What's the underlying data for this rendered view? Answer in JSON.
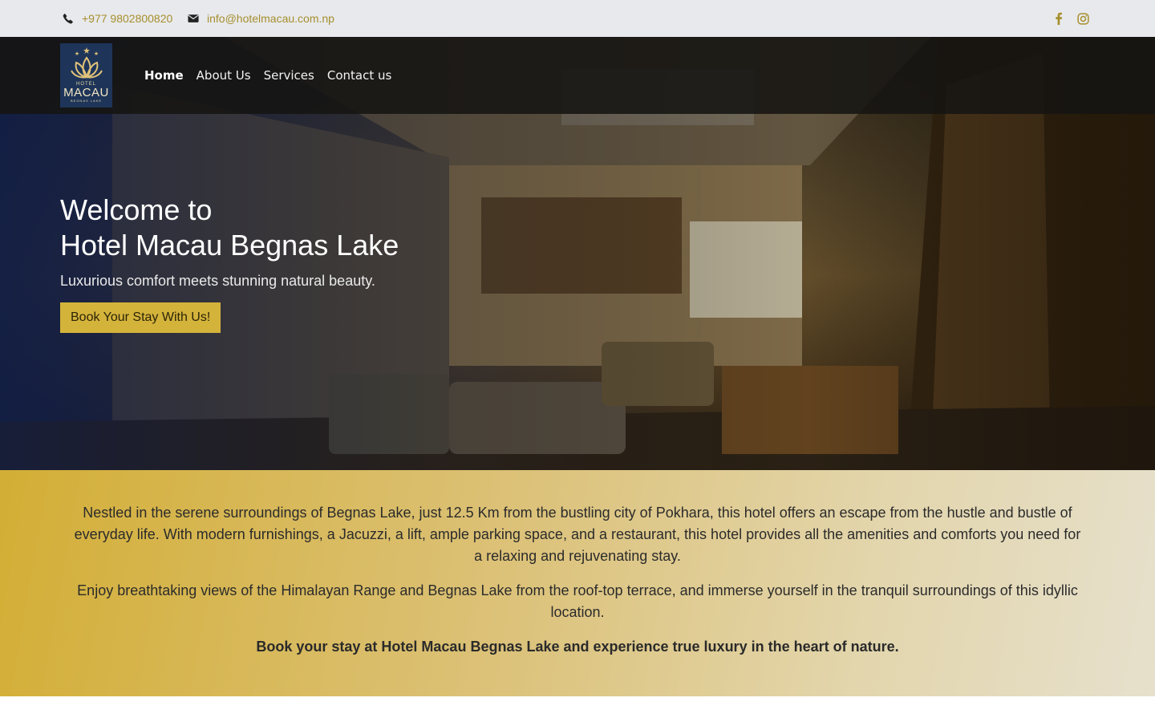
{
  "topbar": {
    "phone": "+977 9802800820",
    "email": "info@hotelmacau.com.np",
    "icons": [
      "phone-icon",
      "envelope-icon",
      "facebook-icon",
      "instagram-icon"
    ],
    "accent_color": "#a68f2c"
  },
  "logo": {
    "line1": "HOTEL",
    "line2": "MACAU",
    "line3": "BEGNAS LAKE"
  },
  "nav": {
    "items": [
      {
        "label": "Home",
        "active": true
      },
      {
        "label": "About Us",
        "active": false
      },
      {
        "label": "Services",
        "active": false
      },
      {
        "label": "Contact us",
        "active": false
      }
    ]
  },
  "hero": {
    "title_line1": "Welcome to",
    "title_line2": "Hotel Macau Begnas Lake",
    "subtitle": "Luxurious comfort meets stunning natural beauty.",
    "cta_label": "Book Your Stay With Us!",
    "cta_color": "#d4b33b"
  },
  "intro": {
    "paragraph1": "Nestled in the serene surroundings of Begnas Lake, just 12.5 Km from the bustling city of Pokhara, this hotel offers an escape from the hustle and bustle of everyday life. With modern furnishings, a Jacuzzi, a lift, ample parking space, and a restaurant, this hotel provides all the amenities and comforts you need for a relaxing and rejuvenating stay.",
    "paragraph2": "Enjoy breathtaking views of the Himalayan Range and Begnas Lake from the roof-top terrace, and immerse yourself in the tranquil surroundings of this idyllic location.",
    "closing": "Book your stay at Hotel Macau Begnas Lake and experience true luxury in the heart of nature."
  }
}
